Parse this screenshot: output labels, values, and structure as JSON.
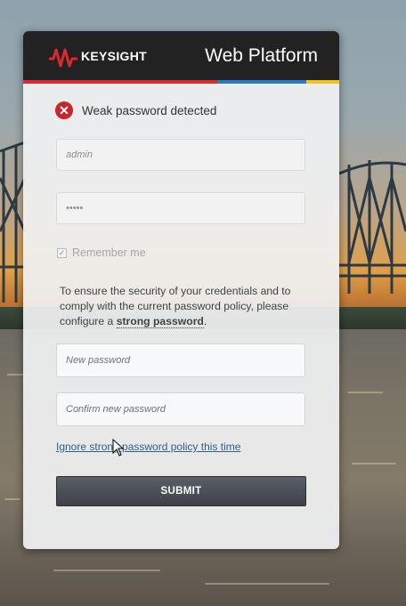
{
  "header": {
    "brand": "KEYSIGHT",
    "platform_title": "Web Platform"
  },
  "alert": {
    "icon": "error-icon",
    "message": "Weak password detected"
  },
  "form": {
    "username_value": "admin",
    "password_value": "•••••",
    "remember_label": "Remember me",
    "remember_checked": true,
    "policy_text_before": "To ensure the security of your credentials and to comply with the current password policy, please configure a ",
    "policy_text_strong": "strong password",
    "policy_text_after": ".",
    "new_password_placeholder": "New password",
    "confirm_password_placeholder": "Confirm new password",
    "ignore_link": "Ignore strong password policy this time",
    "submit_label": "SUBMIT"
  },
  "colors": {
    "header_bg": "#222222",
    "accent_red": "#d62a36",
    "accent_blue": "#2f7bbf",
    "accent_yellow": "#f2c11c",
    "error": "#c7262b"
  }
}
